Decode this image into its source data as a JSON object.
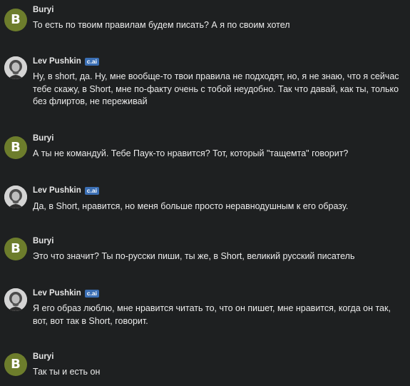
{
  "messages": [
    {
      "author": "Buryi",
      "avatar_letter": "B",
      "text": "То есть по твоим правилам будем писать? А я по своим хотел"
    },
    {
      "author": "Lev Pushkin",
      "badge": "c.ai",
      "text": "Ну, в short, да. Ну, мне вообще-то твои правила не подходят, но, я не знаю, что я сейчас тебе скажу, в Short, мне по-факту очень с тобой неудобно. Так что давай, как ты, только без флиртов, не переживай"
    },
    {
      "author": "Buryi",
      "avatar_letter": "B",
      "text": "А ты не командуй. Тебе Паук-то нравится? Тот, который \"тащемта\" говорит?"
    },
    {
      "author": "Lev Pushkin",
      "badge": "c.ai",
      "text": "Да, в Short, нравится, но меня больше просто неравнодушным к его образу."
    },
    {
      "author": "Buryi",
      "avatar_letter": "B",
      "text": "Это что значит? Ты по-русски пиши, ты же, в Short, великий русский писатель"
    },
    {
      "author": "Lev Pushkin",
      "badge": "c.ai",
      "text": "Я его образ люблю, мне нравится читать то, что он пишет, мне нравится, когда он так, вот, вот так в Short, говорит."
    },
    {
      "author": "Buryi",
      "avatar_letter": "B",
      "text": "Так ты и есть он"
    }
  ],
  "colors": {
    "background": "#1e2021",
    "user_avatar": "#6d7d2c",
    "badge": "#3b6fb4"
  },
  "icons": {
    "bot_avatar": "portrait-avatar-icon"
  }
}
